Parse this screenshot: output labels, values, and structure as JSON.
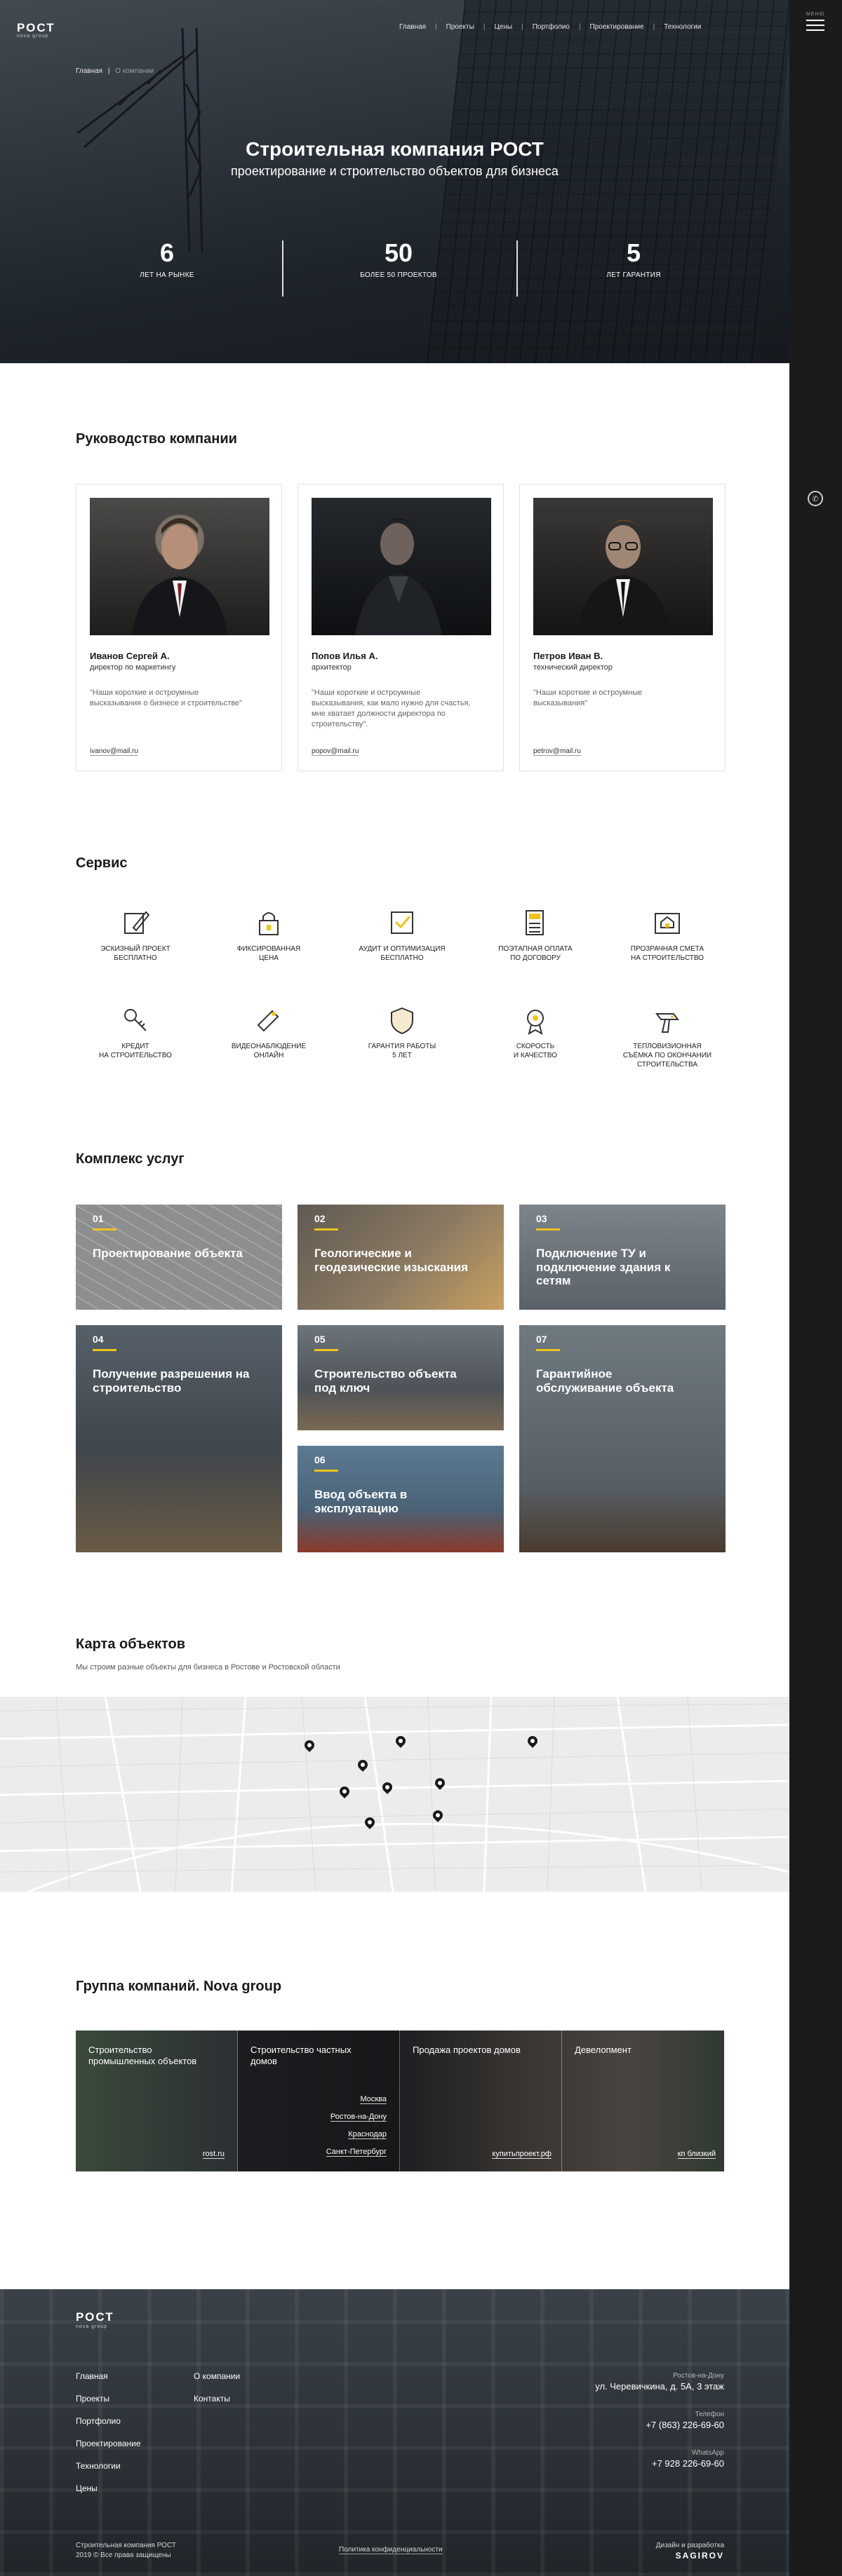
{
  "brand": {
    "logo": "РОСТ",
    "logo_sub": "nova group",
    "burger_label": "МЕНЮ"
  },
  "nav": [
    "Главная",
    "Проекты",
    "Цены",
    "Портфолио",
    "Проектирование",
    "Технологии"
  ],
  "breadcrumb": {
    "home": "Главная",
    "sep": "|",
    "current": "О компании"
  },
  "hero": {
    "title": "Строительная компания РОСТ",
    "subtitle": "проектирование и строительство объектов для бизнеса",
    "stats": [
      {
        "num": "6",
        "label": "ЛЕТ НА РЫНКЕ"
      },
      {
        "num": "50",
        "label": "БОЛЕЕ 50 ПРОЕКТОВ"
      },
      {
        "num": "5",
        "label": "ЛЕТ ГАРАНТИЯ"
      }
    ]
  },
  "management": {
    "title": "Руководство компании",
    "people": [
      {
        "name": "Иванов Сергей А.",
        "role": "директор по маркетингу",
        "quote": "\"Наши короткие и остроумные высказывания о бизнесе и строительстве\"",
        "email": "ivanov@mail.ru"
      },
      {
        "name": "Попов Илья А.",
        "role": "архитектор",
        "quote": "\"Наши короткие и остроумные высказывания, как мало нужно для счастья, мне хватает должности директора по строительству\".",
        "email": "popov@mail.ru"
      },
      {
        "name": "Петров Иван В.",
        "role": "технический директор",
        "quote": "\"Наши короткие и остроумные высказывания\"",
        "email": "petrov@mail.ru"
      }
    ]
  },
  "service": {
    "title": "Сервис",
    "items": [
      {
        "label": "ЭСКИЗНЫЙ ПРОЕКТ\nБЕСПЛАТНО",
        "icon": "sketch-pencil-icon"
      },
      {
        "label": "ФИКСИРОВАННАЯ\nЦЕНА",
        "icon": "lock-icon"
      },
      {
        "label": "АУДИТ И ОПТИМИЗАЦИЯ\nБЕСПЛАТНО",
        "icon": "checkbox-icon"
      },
      {
        "label": "ПОЭТАПНАЯ ОПЛАТА\nПО ДОГОВОРУ",
        "icon": "calculator-icon"
      },
      {
        "label": "ПРОЗРАЧНАЯ СМЕТА\nНА СТРОИТЕЛЬСТВО",
        "icon": "house-plan-icon"
      },
      {
        "label": "КРЕДИТ\nНА СТРОИТЕЛЬСТВО",
        "icon": "key-icon"
      },
      {
        "label": "ВИДЕОНАБЛЮДЕНИЕ\nОНЛАЙН",
        "icon": "camera-icon"
      },
      {
        "label": "ГАРАНТИЯ РАБОТЫ\n5 ЛЕТ",
        "icon": "shield-icon"
      },
      {
        "label": "СКОРОСТЬ\nИ КАЧЕСТВО",
        "icon": "medal-icon"
      },
      {
        "label": "ТЕПЛОВИЗИОННАЯ\nСЪЁМКА ПО ОКОНЧАНИИ\nСТРОИТЕЛЬСТВА",
        "icon": "thermal-camera-icon"
      }
    ]
  },
  "complex": {
    "title": "Комплекс услуг",
    "tiles": [
      {
        "num": "01",
        "title": "Проектирование объекта"
      },
      {
        "num": "02",
        "title": "Геологические и геодезические изыскания"
      },
      {
        "num": "03",
        "title": "Подключение ТУ и подключение здания к сетям"
      },
      {
        "num": "04",
        "title": "Получение разрешения на строительство"
      },
      {
        "num": "05",
        "title": "Строительство объекта под ключ"
      },
      {
        "num": "06",
        "title": "Ввод объекта в эксплуатацию"
      },
      {
        "num": "07",
        "title": "Гарантийное обслуживание объекта"
      }
    ]
  },
  "map": {
    "title": "Карта объектов",
    "subtitle": "Мы строим разные объекты для бизнеса в Ростове и Ростовской области"
  },
  "group": {
    "title": "Группа компаний. Nova group",
    "columns": [
      {
        "title": "Строительство промышленных объектов",
        "link": "rost.ru"
      },
      {
        "title": "Строительство частных домов",
        "cities": [
          "Москва",
          "Ростов-на-Дону",
          "Краснодар",
          "Санкт-Петербург"
        ]
      },
      {
        "title": "Продажа проектов домов",
        "link": "купитьпроект.рф"
      },
      {
        "title": "Девелопмент",
        "link": "кп близкий"
      }
    ]
  },
  "footer": {
    "links_col1": [
      "Главная",
      "Проекты",
      "Портфолио",
      "Проектирование",
      "Технологии",
      "Цены"
    ],
    "links_col2": [
      "О компании",
      "Контакты"
    ],
    "address_label": "Ростов-на-Дону",
    "address": "ул. Черевичкина, д. 5А, 3 этаж",
    "phone_label": "Телефон",
    "phone": "+7 (863) 226-69-60",
    "whatsapp_label": "WhatsApp",
    "whatsapp": "+7 928 226-69-60",
    "copyright_1": "Строительная компания РОСТ",
    "copyright_2": "2019 © Все права защищены",
    "privacy": "Политика конфиденциальности",
    "dev_label": "Дизайн и разработка",
    "dev": "SAGIROV"
  }
}
